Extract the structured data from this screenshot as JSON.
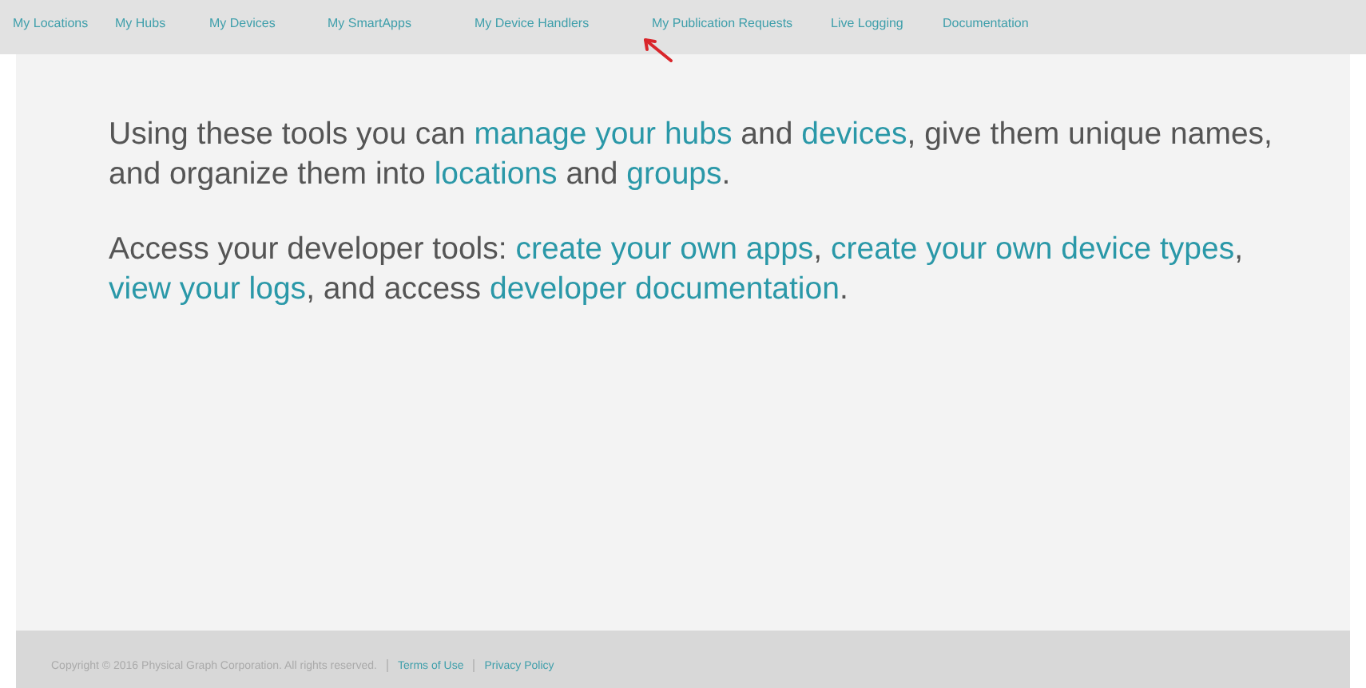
{
  "nav": {
    "items": [
      "My Locations",
      "My Hubs",
      "My Devices",
      "My SmartApps",
      "My Device Handlers",
      "My Publication Requests",
      "Live Logging",
      "Documentation"
    ]
  },
  "intro": {
    "paragraphs": [
      [
        {
          "kind": "text",
          "text": "Using these tools you can "
        },
        {
          "kind": "link",
          "text": "manage your hubs"
        },
        {
          "kind": "text",
          "text": " and "
        },
        {
          "kind": "link",
          "text": "devices"
        },
        {
          "kind": "text",
          "text": ", give them unique names, and organize them into "
        },
        {
          "kind": "link",
          "text": "locations"
        },
        {
          "kind": "text",
          "text": " and "
        },
        {
          "kind": "link",
          "text": "groups"
        },
        {
          "kind": "text",
          "text": "."
        }
      ],
      [
        {
          "kind": "text",
          "text": "Access your developer tools: "
        },
        {
          "kind": "link",
          "text": "create your own apps"
        },
        {
          "kind": "text",
          "text": ", "
        },
        {
          "kind": "link",
          "text": "create your own device types"
        },
        {
          "kind": "text",
          "text": ", "
        },
        {
          "kind": "link",
          "text": "view your logs"
        },
        {
          "kind": "text",
          "text": ", and access "
        },
        {
          "kind": "link",
          "text": "developer documentation"
        },
        {
          "kind": "text",
          "text": "."
        }
      ]
    ]
  },
  "footer": {
    "copyright": "Copyright © 2016 Physical Graph Corporation. All rights reserved.",
    "links": [
      "Terms of Use",
      "Privacy Policy"
    ]
  }
}
